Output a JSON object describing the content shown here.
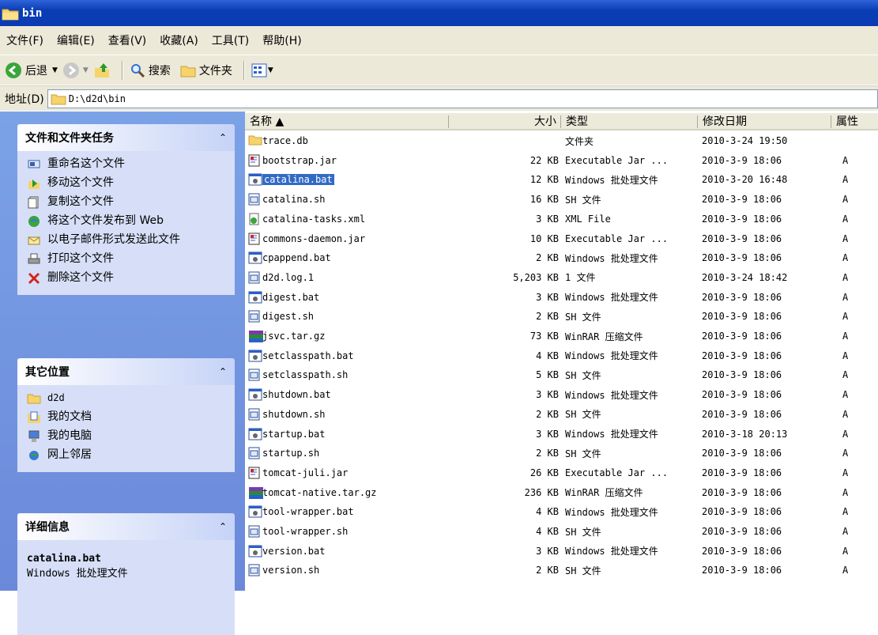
{
  "window": {
    "title": "bin"
  },
  "menu": [
    "文件(F)",
    "编辑(E)",
    "查看(V)",
    "收藏(A)",
    "工具(T)",
    "帮助(H)"
  ],
  "toolbar": {
    "back": "后退",
    "search": "搜索",
    "folders": "文件夹"
  },
  "address": {
    "label": "地址(D)",
    "value": "D:\\d2d\\bin"
  },
  "tasks_panel": {
    "title": "文件和文件夹任务",
    "items": [
      {
        "label": "重命名这个文件",
        "icon": "rename-icon"
      },
      {
        "label": "移动这个文件",
        "icon": "move-icon"
      },
      {
        "label": "复制这个文件",
        "icon": "copy-icon"
      },
      {
        "label": "将这个文件发布到 Web",
        "icon": "publish-web-icon"
      },
      {
        "label": "以电子邮件形式发送此文件",
        "icon": "email-icon"
      },
      {
        "label": "打印这个文件",
        "icon": "print-icon"
      },
      {
        "label": "删除这个文件",
        "icon": "delete-icon"
      }
    ]
  },
  "places_panel": {
    "title": "其它位置",
    "items": [
      {
        "label": "d2d",
        "icon": "folder-icon"
      },
      {
        "label": "我的文档",
        "icon": "my-documents-icon"
      },
      {
        "label": "我的电脑",
        "icon": "my-computer-icon"
      },
      {
        "label": "网上邻居",
        "icon": "network-places-icon"
      }
    ]
  },
  "details_panel": {
    "title": "详细信息",
    "name": "catalina.bat",
    "type": "Windows 批处理文件"
  },
  "columns": {
    "name": "名称 ▲",
    "size": "大小",
    "type": "类型",
    "modified": "修改日期",
    "attr": "属性"
  },
  "files": [
    {
      "name": "trace.db",
      "size": "",
      "type": "文件夹",
      "modified": "2010-3-24 19:50",
      "attr": "",
      "icon": "folder-icon"
    },
    {
      "name": "bootstrap.jar",
      "size": "22 KB",
      "type": "Executable Jar ...",
      "modified": "2010-3-9 18:06",
      "attr": "A",
      "icon": "jar-icon"
    },
    {
      "name": "catalina.bat",
      "size": "12 KB",
      "type": "Windows 批处理文件",
      "modified": "2010-3-20 16:48",
      "attr": "A",
      "icon": "bat-icon",
      "selected": true
    },
    {
      "name": "catalina.sh",
      "size": "16 KB",
      "type": "SH 文件",
      "modified": "2010-3-9 18:06",
      "attr": "A",
      "icon": "generic-file-icon"
    },
    {
      "name": "catalina-tasks.xml",
      "size": "3 KB",
      "type": "XML File",
      "modified": "2010-3-9 18:06",
      "attr": "A",
      "icon": "xml-icon"
    },
    {
      "name": "commons-daemon.jar",
      "size": "10 KB",
      "type": "Executable Jar ...",
      "modified": "2010-3-9 18:06",
      "attr": "A",
      "icon": "jar-icon"
    },
    {
      "name": "cpappend.bat",
      "size": "2 KB",
      "type": "Windows 批处理文件",
      "modified": "2010-3-9 18:06",
      "attr": "A",
      "icon": "bat-icon"
    },
    {
      "name": "d2d.log.1",
      "size": "5,203 KB",
      "type": "1 文件",
      "modified": "2010-3-24 18:42",
      "attr": "A",
      "icon": "generic-file-icon"
    },
    {
      "name": "digest.bat",
      "size": "3 KB",
      "type": "Windows 批处理文件",
      "modified": "2010-3-9 18:06",
      "attr": "A",
      "icon": "bat-icon"
    },
    {
      "name": "digest.sh",
      "size": "2 KB",
      "type": "SH 文件",
      "modified": "2010-3-9 18:06",
      "attr": "A",
      "icon": "generic-file-icon"
    },
    {
      "name": "jsvc.tar.gz",
      "size": "73 KB",
      "type": "WinRAR 压缩文件",
      "modified": "2010-3-9 18:06",
      "attr": "A",
      "icon": "winrar-icon"
    },
    {
      "name": "setclasspath.bat",
      "size": "4 KB",
      "type": "Windows 批处理文件",
      "modified": "2010-3-9 18:06",
      "attr": "A",
      "icon": "bat-icon"
    },
    {
      "name": "setclasspath.sh",
      "size": "5 KB",
      "type": "SH 文件",
      "modified": "2010-3-9 18:06",
      "attr": "A",
      "icon": "generic-file-icon"
    },
    {
      "name": "shutdown.bat",
      "size": "3 KB",
      "type": "Windows 批处理文件",
      "modified": "2010-3-9 18:06",
      "attr": "A",
      "icon": "bat-icon"
    },
    {
      "name": "shutdown.sh",
      "size": "2 KB",
      "type": "SH 文件",
      "modified": "2010-3-9 18:06",
      "attr": "A",
      "icon": "generic-file-icon"
    },
    {
      "name": "startup.bat",
      "size": "3 KB",
      "type": "Windows 批处理文件",
      "modified": "2010-3-18 20:13",
      "attr": "A",
      "icon": "bat-icon"
    },
    {
      "name": "startup.sh",
      "size": "2 KB",
      "type": "SH 文件",
      "modified": "2010-3-9 18:06",
      "attr": "A",
      "icon": "generic-file-icon"
    },
    {
      "name": "tomcat-juli.jar",
      "size": "26 KB",
      "type": "Executable Jar ...",
      "modified": "2010-3-9 18:06",
      "attr": "A",
      "icon": "jar-icon"
    },
    {
      "name": "tomcat-native.tar.gz",
      "size": "236 KB",
      "type": "WinRAR 压缩文件",
      "modified": "2010-3-9 18:06",
      "attr": "A",
      "icon": "winrar-icon"
    },
    {
      "name": "tool-wrapper.bat",
      "size": "4 KB",
      "type": "Windows 批处理文件",
      "modified": "2010-3-9 18:06",
      "attr": "A",
      "icon": "bat-icon"
    },
    {
      "name": "tool-wrapper.sh",
      "size": "4 KB",
      "type": "SH 文件",
      "modified": "2010-3-9 18:06",
      "attr": "A",
      "icon": "generic-file-icon"
    },
    {
      "name": "version.bat",
      "size": "3 KB",
      "type": "Windows 批处理文件",
      "modified": "2010-3-9 18:06",
      "attr": "A",
      "icon": "bat-icon"
    },
    {
      "name": "version.sh",
      "size": "2 KB",
      "type": "SH 文件",
      "modified": "2010-3-9 18:06",
      "attr": "A",
      "icon": "generic-file-icon"
    }
  ]
}
